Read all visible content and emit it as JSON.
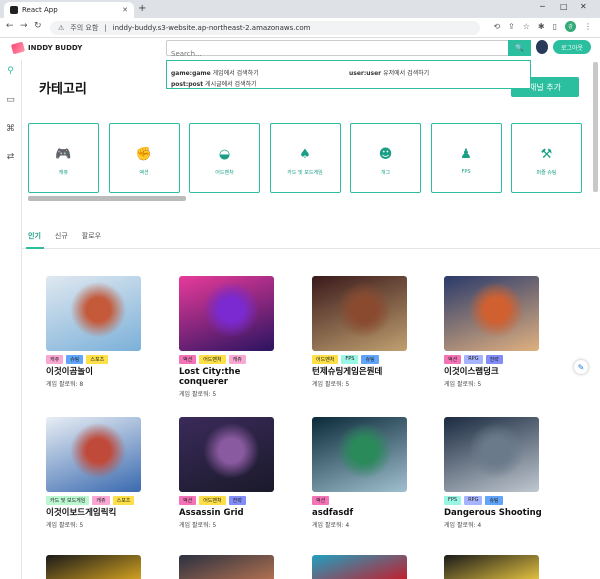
{
  "browser": {
    "tab_title": "React App",
    "security_label": "주의 요함",
    "url": "inddy-buddy.s3-website.ap-northeast-2.amazonaws.com",
    "profile_initials": "강"
  },
  "header": {
    "logo_text": "INDDY BUDDY",
    "search_placeholder": "Search...",
    "search_button": "🔍",
    "logout_label": "로그아웃"
  },
  "search_hints": [
    {
      "key": "game:game",
      "desc": "게임에서 검색하기"
    },
    {
      "key": "user:user",
      "desc": "유저에서 검색하기"
    },
    {
      "key": "post:post",
      "desc": "게시글에서 검색하기"
    }
  ],
  "category": {
    "title": "카테고리",
    "add_button": "채널 추가",
    "items": [
      {
        "label": "캐쥬",
        "icon": "gamepad-icon"
      },
      {
        "label": "액션",
        "icon": "fist-icon"
      },
      {
        "label": "어드벤처",
        "icon": "hat-icon"
      },
      {
        "label": "카드 및 보드게임",
        "icon": "card-icon"
      },
      {
        "label": "개그",
        "icon": "smile-icon"
      },
      {
        "label": "FPS",
        "icon": "person-icon"
      },
      {
        "label": "퍼즐 슈팅",
        "icon": "axe-icon"
      }
    ]
  },
  "tabs": [
    {
      "label": "인기",
      "active": true
    },
    {
      "label": "신규",
      "active": false
    },
    {
      "label": "팔로우",
      "active": false
    }
  ],
  "tag_colors": {
    "캐쥬": "#f9a8d4",
    "슈팅": "#60a5fa",
    "스포츠": "#fde047",
    "액션": "#f472b6",
    "어드벤처": "#fde047",
    "FPS": "#99f6e4",
    "RPG": "#a5b4fc",
    "카드 및 보드게임": "#bbf7d0",
    "전략": "#818cf8",
    "공포": "#c084fc"
  },
  "games": [
    {
      "title": "이것이곰놀이",
      "tags": [
        "캐쥬",
        "슈팅",
        "스포츠"
      ],
      "followers": "게임 팔로워: 8",
      "thumb": [
        "#dfe8f0",
        "#c45a3a",
        "#7bb0d9"
      ]
    },
    {
      "title": "Lost City:the conquerer",
      "tags": [
        "액션",
        "어드벤처",
        "캐쥬"
      ],
      "followers": "게임 팔로워: 5",
      "thumb": [
        "#e83a9a",
        "#7a2ad0",
        "#2a1460"
      ]
    },
    {
      "title": "턴제슈팅게임은뭔데",
      "tags": [
        "어드벤처",
        "FPS",
        "슈팅"
      ],
      "followers": "게임 팔로워: 5",
      "thumb": [
        "#3a1a1a",
        "#8a4a30",
        "#c0a070"
      ]
    },
    {
      "title": "이것이스램덩크",
      "tags": [
        "액션",
        "RPG",
        "전략"
      ],
      "followers": "게임 팔로워: 5",
      "thumb": [
        "#2a3a6a",
        "#d06030",
        "#e0b080"
      ]
    },
    {
      "title": "이것이보드게임릭킥",
      "tags": [
        "카드 및 보드게임",
        "캐쥬",
        "스포츠"
      ],
      "followers": "게임 팔로워: 5",
      "thumb": [
        "#e8eef4",
        "#c04a3a",
        "#3a6ab0"
      ]
    },
    {
      "title": "Assassin Grid",
      "tags": [
        "액션",
        "어드벤처",
        "전략"
      ],
      "followers": "게임 팔로워: 5",
      "thumb": [
        "#3a2a5a",
        "#8a5aa0",
        "#1a1a2a"
      ]
    },
    {
      "title": "asdfasdf",
      "tags": [
        "액션"
      ],
      "followers": "게임 팔로워: 4",
      "thumb": [
        "#0a2a3a",
        "#2a8a5a",
        "#a0c0d0"
      ]
    },
    {
      "title": "Dangerous Shooting",
      "tags": [
        "FPS",
        "RPG",
        "슈팅"
      ],
      "followers": "게임 팔로워: 4",
      "thumb": [
        "#1a2a40",
        "#6a7a8a",
        "#c0c8d0"
      ]
    }
  ],
  "partial_row_thumbs": [
    [
      "#1a1a1a",
      "#d0a020"
    ],
    [
      "#2a3040",
      "#b07050"
    ],
    [
      "#20a0c0",
      "#c02030"
    ],
    [
      "#1a1a1a",
      "#e0c040"
    ]
  ]
}
